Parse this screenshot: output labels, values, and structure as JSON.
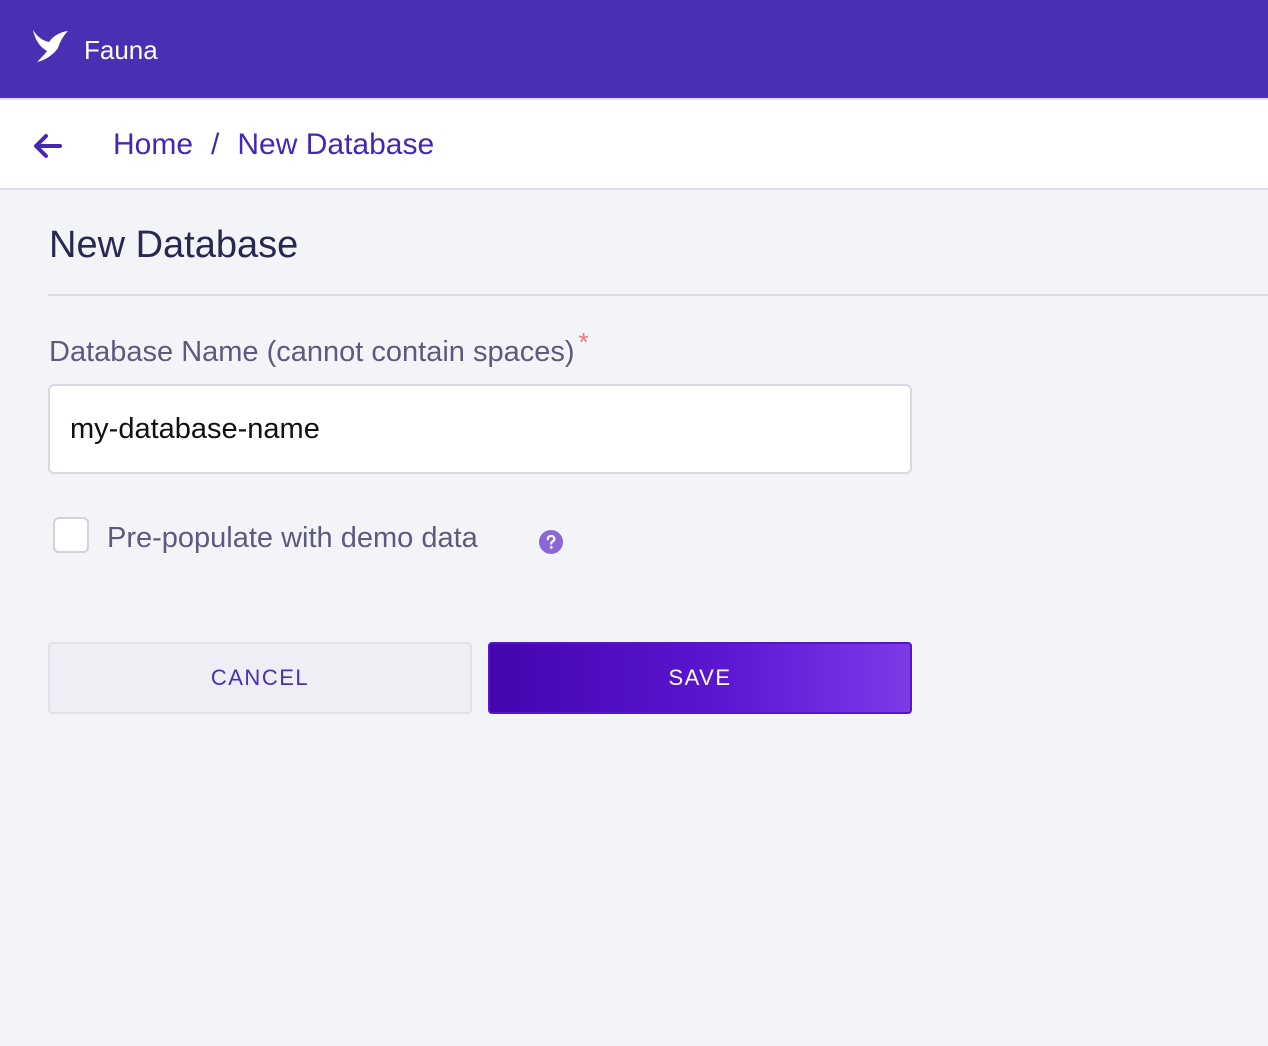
{
  "header": {
    "app_name": "Fauna",
    "logo_icon": "fauna-bird-logo",
    "background_color": "#4a2fb4"
  },
  "breadcrumb": {
    "back_icon": "arrow-left-icon",
    "items": [
      "Home",
      "New Database"
    ],
    "separator": "/"
  },
  "page": {
    "title": "New Database"
  },
  "form": {
    "name_label": "Database Name (cannot contain spaces)",
    "required_marker": "*",
    "name_value": "my-database-name",
    "demo_checkbox_label": "Pre-populate with demo data",
    "demo_checked": false,
    "help_icon": "question-circle-icon",
    "cancel_label": "CANCEL",
    "save_label": "SAVE"
  },
  "colors": {
    "accent": "#4a2fb4",
    "required": "#f1777a",
    "save_gradient_start": "#4305ae",
    "save_gradient_end": "#7d3ae8"
  }
}
